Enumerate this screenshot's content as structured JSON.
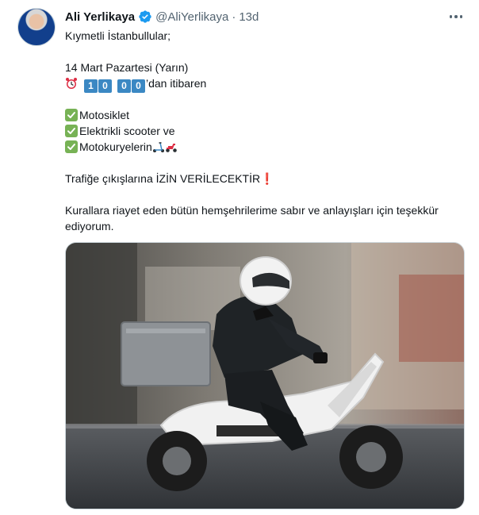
{
  "tweet": {
    "author_name": "Ali Yerlikaya",
    "author_handle": "@AliYerlikaya",
    "separator": "·",
    "time": "13d",
    "lines": {
      "l1": "Kıymetli İstanbullular;",
      "l2": "14 Mart Pazartesi (Yarın)",
      "time_digits": [
        "1",
        "0",
        "0",
        "0"
      ],
      "l3_suffix": "’dan itibaren",
      "item1": "Motosiklet",
      "item2": "Elektrikli scooter ve",
      "item3": "Motokuryelerin",
      "l4": "Trafiğe çıkışlarına İZİN VERİLECEKTİR",
      "l5a": "Kurallara riayet eden bütün hemşehrilerime sabır ve anlayışları için teşekkür",
      "l5b": "ediyorum."
    },
    "icons": {
      "verified": "verified-badge-icon",
      "more": "more-options-icon",
      "clock": "alarm-clock-icon",
      "check": "check-mark-button-icon",
      "scooter": "kick-scooter-icon",
      "motor_scooter": "motor-scooter-icon",
      "exclamation": "red-exclamation-icon"
    },
    "exclamation_glyph": "❗",
    "colors": {
      "accent": "#1d9bf0",
      "text": "#0f1419",
      "muted": "#536471",
      "check_green": "#77b255",
      "keycap_blue": "#3b88c3"
    }
  }
}
